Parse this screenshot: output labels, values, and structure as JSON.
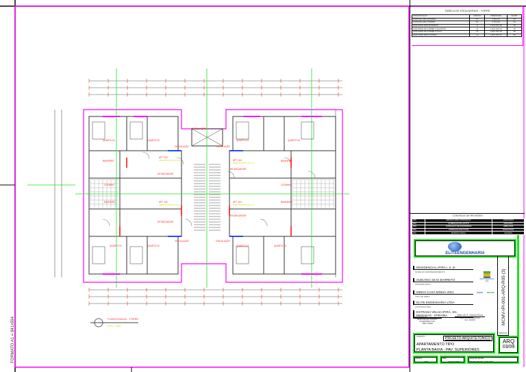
{
  "sheet": {
    "format_label": "FORMATO A1 = 841x594",
    "frame_color": "#ff00ff"
  },
  "schedule": {
    "title": "TABELA DE ESQUADRIAS - TORRE",
    "headers": [
      "ESPECIFICAÇÃO",
      "CÓDIGO",
      "DIMENSÕES",
      "QUANT."
    ],
    "rows": [
      [
        "PORTA DE GIRO EXTERNA",
        "P1",
        "0,80x2,10",
        "08"
      ],
      [
        "PORTA DE GIRO INTERNA",
        "P2",
        "0,70x2,10",
        "24"
      ],
      [
        "ESQUADRIA PARA BANHEIRO",
        "J1",
        "0,60x0,60/1,50",
        "08"
      ],
      [
        "ESQUADRIA DE CORRER P/ QUARTOS",
        "J2",
        "1,20x1,00/1,10",
        "16"
      ],
      [
        "ESQUADRIA DE CORRER P/ SALA",
        "J3",
        "1,50x1,20/1,00",
        "08"
      ],
      [
        "ESQUADRIA PARA COZINHA",
        "J4",
        "1,00x1,00/1,10",
        "08"
      ]
    ]
  },
  "revisions": {
    "title": "CONTROLE DE REVISÕES",
    "rows": [
      [
        "R05",
        "EMISSÃO PARA APROVAÇÃO",
        "JUNHO/2024"
      ],
      [
        "R04",
        "ALTERAÇÃO DE LAYOUT",
        "MAIO/2024"
      ],
      [
        "R03",
        "ALTERAÇÃO DE ESQUADRIAS",
        "ABRIL/2024"
      ],
      [
        "R02",
        "ALTERAÇÃO DE COTAS",
        "MARÇO/2024"
      ],
      [
        "R01",
        "EMISSÃO INICIAL",
        "FEV/2024"
      ]
    ]
  },
  "logo": {
    "text": "ELITEENGENHARIA"
  },
  "fields": [
    {
      "value": "RESIDENCIAL IPIRÁ I, II, III",
      "label": "NOME DO EMPREENDIMENTO"
    },
    {
      "value": "SUELTECI DIAS BARRETO",
      "label": "PROPRIETÁRIO"
    },
    {
      "value": "MINHA CASA MINHA VIDA",
      "label": "TIPO DE OBRA"
    },
    {
      "value": "ELITE ENGENHARIA LTDA",
      "label": "CONSTRUTORA"
    },
    {
      "value": "ESTRADA VELHA IPIRÁ, SN, PINTADAS - IPIRÁ/BA",
      "label": "ENDEREÇO"
    }
  ],
  "partner_logos": {
    "mcmv": "Minha Casa Minha Vida",
    "caixa": "CAIXA",
    "gov": "BRASIL"
  },
  "signatures": {
    "left_name": "RESPONSÁVEL TÉCNICO",
    "left_role": "ENGENHEIRO CIVIL",
    "left_reg": "CREA: 000000",
    "right_name": "Aline de S. Garcia Rosa",
    "right_role": "ARQUITETA E URBANISTA",
    "right_reg": "CAU: A000000"
  },
  "drawing_code": "MCMV-IPI-001-ARQ-R05 (3)",
  "project": {
    "label": "ASSUNTO",
    "discipline": "PROJETO ARQUITETÔNICO",
    "line1": "APARTAMENTO TIPO",
    "line2": "PLANTA BAIXA - PAV. SUPERIORES"
  },
  "sheet_no": {
    "label": "PRANCHA",
    "code": "ARQ",
    "number": "03/09"
  },
  "footer": {
    "scale_label": "ESCALA",
    "scale": "1/50",
    "date_label": "DATA",
    "date": "JUNHO 2024",
    "file_label": "ARQUIVO DIGITAL",
    "file": "MCMV-IPI-001-ARQ-R05"
  },
  "plan_title": {
    "title": "PLANTA BAIXA - TORRE",
    "scale": "ESC.: 1/50"
  },
  "rooms": {
    "q1": "QUARTO 01",
    "q2": "QUARTO 02",
    "q3": "QUARTO 03",
    "q4": "QUARTO 04",
    "bwc": "BANHEIRO",
    "coz": "COZINHA",
    "estar": "ESTAR/JANTAR",
    "circ": "CIRCULAÇÃO",
    "apt103": "APT. 103",
    "apt104": "APT. 104",
    "apt102": "APT. 102",
    "apt101": "APT. 101",
    "area": "ÁREA PRIVATIVA 40,13 m²"
  }
}
